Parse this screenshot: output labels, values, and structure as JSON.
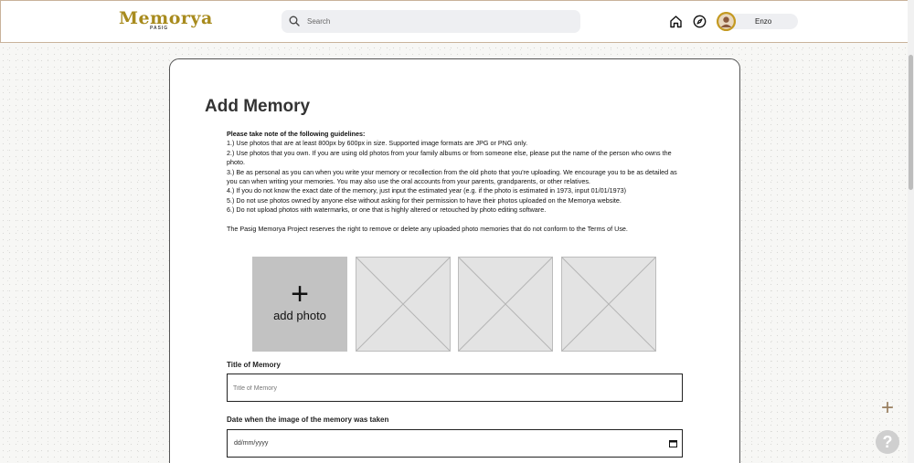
{
  "brand": {
    "name": "Memorya",
    "subtitle": "PASIG",
    "accent_color": "#a88b1e"
  },
  "header": {
    "search": {
      "placeholder": "Search",
      "icon": "search-icon"
    },
    "nav_icons": [
      "home-icon",
      "compass-icon"
    ],
    "user": {
      "name": "Enzo",
      "avatar": "user-avatar"
    }
  },
  "page": {
    "title": "Add Memory",
    "guidelines": {
      "heading": "Please take note of the following guidelines:",
      "items": [
        "1.) Use photos that are at least 800px by 600px in size. Supported image formats are JPG or PNG only.",
        "2.) Use photos that you own. If you are using old photos from your family albums or from someone else, please put the name of the person who owns the photo.",
        "3.) Be as personal as you can when you write your memory or recollection from the old photo that you're uploading. We encourage you to be as detailed as you can when writing your memories. You may also use the oral accounts from your parents, grandparents, or other relatives.",
        "4.) If you do not know the exact date of the memory, just input the estimated year (e.g. if the photo is estimated in 1973, input 01/01/1973)",
        "5.) Do not use photos owned by anyone else without asking for their permission to have their photos uploaded on the Memorya website.",
        "6.) Do not upload photos with watermarks, or one that is highly altered or retouched by photo editing software."
      ],
      "note": "The Pasig Memorya Project reserves the right to remove or delete any uploaded photo memories that do not conform to the Terms of Use."
    },
    "photo_upload": {
      "add_label": "add photo",
      "add_icon": "plus-icon"
    },
    "form": {
      "title_label": "Title of Memory",
      "title_placeholder": "Title of Memory",
      "date_label": "Date when the image of the memory was taken",
      "date_placeholder": "dd/mm/yyyy"
    }
  },
  "floating": {
    "add_icon": "plus-icon",
    "help_icon": "help-icon",
    "help_label": "?"
  }
}
